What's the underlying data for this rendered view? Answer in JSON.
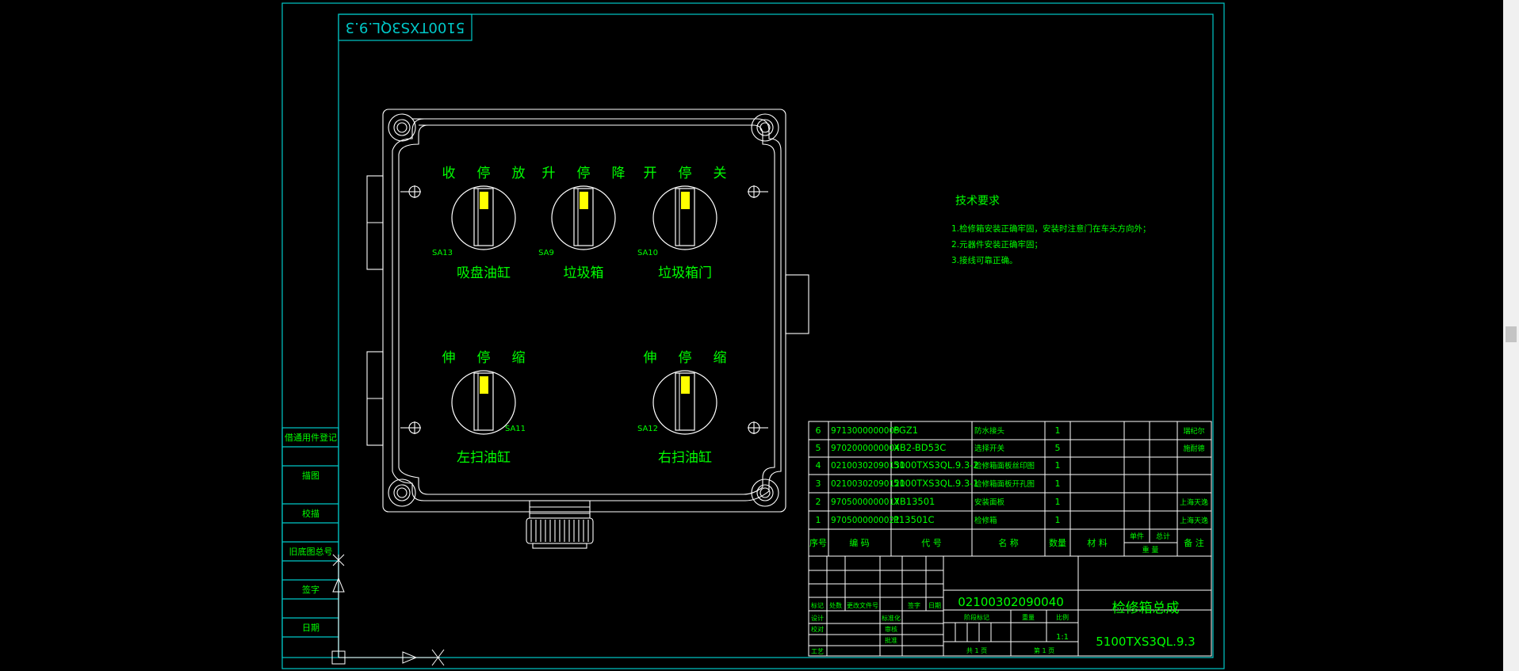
{
  "drawing": {
    "rotated_code": "5100TXS3QL.9.3",
    "tech_req": {
      "title": "技术要求",
      "items": [
        "1.检修箱安装正确牢固，安装时注意门在车头方向外；",
        "2.元器件安装正确牢固；",
        "3.接线可靠正确。"
      ]
    },
    "switches": [
      {
        "id": "SA13",
        "top": [
          "收",
          "停",
          "放"
        ],
        "name": "吸盘油缸"
      },
      {
        "id": "SA9",
        "top": [
          "升",
          "停",
          "降"
        ],
        "name": "垃圾箱"
      },
      {
        "id": "SA10",
        "top": [
          "开",
          "停",
          "关"
        ],
        "name": "垃圾箱门"
      },
      {
        "id": "SA11",
        "top": [
          "伸",
          "停",
          "缩"
        ],
        "name": "左扫油缸"
      },
      {
        "id": "SA12",
        "top": [
          "伸",
          "停",
          "缩"
        ],
        "name": "右扫油缸"
      }
    ],
    "side_labels": [
      "借通用件登记",
      "描图",
      "校描",
      "旧底图总号",
      "签字",
      "日期"
    ],
    "bom": {
      "rows": [
        {
          "no": "6",
          "code": "9713000000005",
          "model": "PGZ1",
          "name": "防水接头",
          "qty": "1",
          "remark": "瑞纪尔"
        },
        {
          "no": "5",
          "code": "9702000000004",
          "model": "XB2-BD53C",
          "name": "选择开关",
          "qty": "5",
          "remark": "施耐德"
        },
        {
          "no": "4",
          "code": "02100302090130",
          "model": "5100TXS3QL.9.3-2",
          "name": "检修箱面板丝印图",
          "qty": "1",
          "remark": ""
        },
        {
          "no": "3",
          "code": "02100302090120",
          "model": "5100TXS3QL.9.3-1",
          "name": "检修箱面板开孔图",
          "qty": "1",
          "remark": ""
        },
        {
          "no": "2",
          "code": "9705000000017",
          "model": "XB13501",
          "name": "安装面板",
          "qty": "1",
          "remark": "上海天逸"
        },
        {
          "no": "1",
          "code": "9705000000021",
          "model": "P13501C",
          "name": "检修箱",
          "qty": "1",
          "remark": "上海天逸"
        }
      ],
      "header": {
        "no": "序号",
        "code": "编 码",
        "model": "代 号",
        "name": "名 称",
        "qty": "数量",
        "material": "材 料",
        "unit": "单件",
        "total": "总计",
        "weight": "重 量",
        "remark": "备 注"
      }
    },
    "title_block": {
      "drawing_no": "02100302090040",
      "title": "检修箱总成",
      "code": "5100TXS3QL.9.3",
      "scale": "1:1",
      "labels": {
        "mark": "标记",
        "count": "处数",
        "change_file": "更改文件号",
        "sign": "签字",
        "date": "日期",
        "design": "设计",
        "standardization": "标准化",
        "proofread": "校对",
        "review": "审核",
        "process": "工艺",
        "approve": "批准",
        "stage": "阶段标记",
        "weight": "重量",
        "scale": "比例",
        "sheet_total": "共 1 页",
        "sheet_no": "第 1 页"
      }
    },
    "colors": {
      "frame": "#00c8c8",
      "white": "#ffffff",
      "text": "#00ff00",
      "yellow": "#ffff00"
    }
  }
}
